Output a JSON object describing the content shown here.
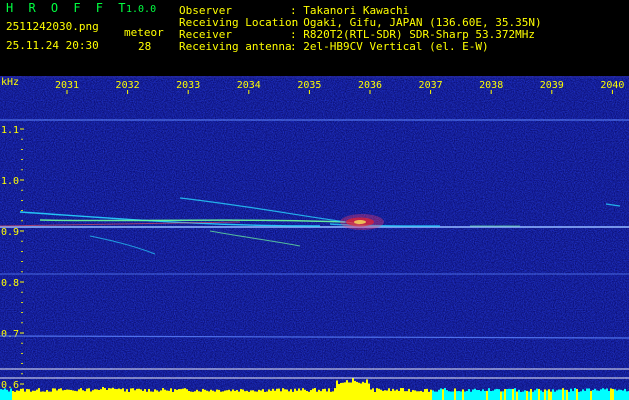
{
  "app": {
    "title": "H R O F F T",
    "version": "1.0.0",
    "filename": "2511242030.png",
    "datetime": "25.11.24 20:30",
    "meteor_label": "meteor",
    "meteor_count": "28"
  },
  "info": {
    "rows": [
      {
        "label": "Observer",
        "value": ": Takanori Kawachi"
      },
      {
        "label": "Receiving Location",
        "value": ": Ogaki, Gifu, JAPAN (136.60E, 35.35N)"
      },
      {
        "label": "Receiver",
        "value": ": R820T2(RTL-SDR) SDR-Sharp 53.372MHz"
      },
      {
        "label": "Receiving antenna",
        "value": ": 2el-HB9CV Vertical (el. E-W)"
      }
    ]
  },
  "axes": {
    "y_unit": "kHz",
    "y_ticks": [
      "1.1",
      "1.0",
      "0.9",
      "0.8",
      "0.7",
      "0.6"
    ],
    "x_ticks": [
      "2031",
      "2032",
      "2033",
      "2034",
      "2035",
      "2036",
      "2037",
      "2038",
      "2039",
      "2040"
    ]
  },
  "colors": {
    "background": "#0a0a6e",
    "text": "#ffff00",
    "title": "#00ff40",
    "grid": "#ffffff",
    "signal_line": "#6fa8ff",
    "level_bar": "#ffff00",
    "level_bar_alt": "#00ffff"
  }
}
